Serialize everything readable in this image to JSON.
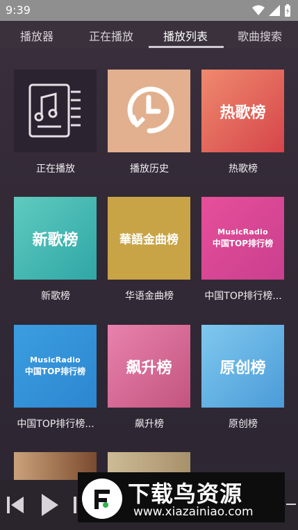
{
  "status": {
    "time": "9:39"
  },
  "tabs": [
    {
      "label": "播放器"
    },
    {
      "label": "正在播放"
    },
    {
      "label": "播放列表",
      "active": true
    },
    {
      "label": "歌曲搜索"
    }
  ],
  "grid": [
    {
      "caption": "正在播放",
      "thumb_text": "",
      "icon": "music-document-icon"
    },
    {
      "caption": "播放历史",
      "thumb_text": "",
      "icon": "history-clock-icon"
    },
    {
      "caption": "热歌榜",
      "thumb_text": "热歌榜"
    },
    {
      "caption": "新歌榜",
      "thumb_text": "新歌榜"
    },
    {
      "caption": "华语金曲榜",
      "thumb_text": "華語金曲榜"
    },
    {
      "caption": "中国TOP排行榜...",
      "thumb_line1": "MusicRadio",
      "thumb_line2": "中国TOP排行榜"
    },
    {
      "caption": "中国TOP排行榜...",
      "thumb_line1": "MusicRadio",
      "thumb_line2": "中国TOP排行榜"
    },
    {
      "caption": "飙升榜",
      "thumb_text": "飙升榜"
    },
    {
      "caption": "原创榜",
      "thumb_text": "原创榜"
    }
  ],
  "player": {
    "prev_icon": "skip-previous-icon",
    "play_icon": "play-icon"
  },
  "watermark": {
    "title": "下载鸟资源",
    "url": "www.xiazainiao.com"
  },
  "colors": {
    "tab_bg": "#3b313d",
    "status_bg": "#8f8f8f"
  }
}
